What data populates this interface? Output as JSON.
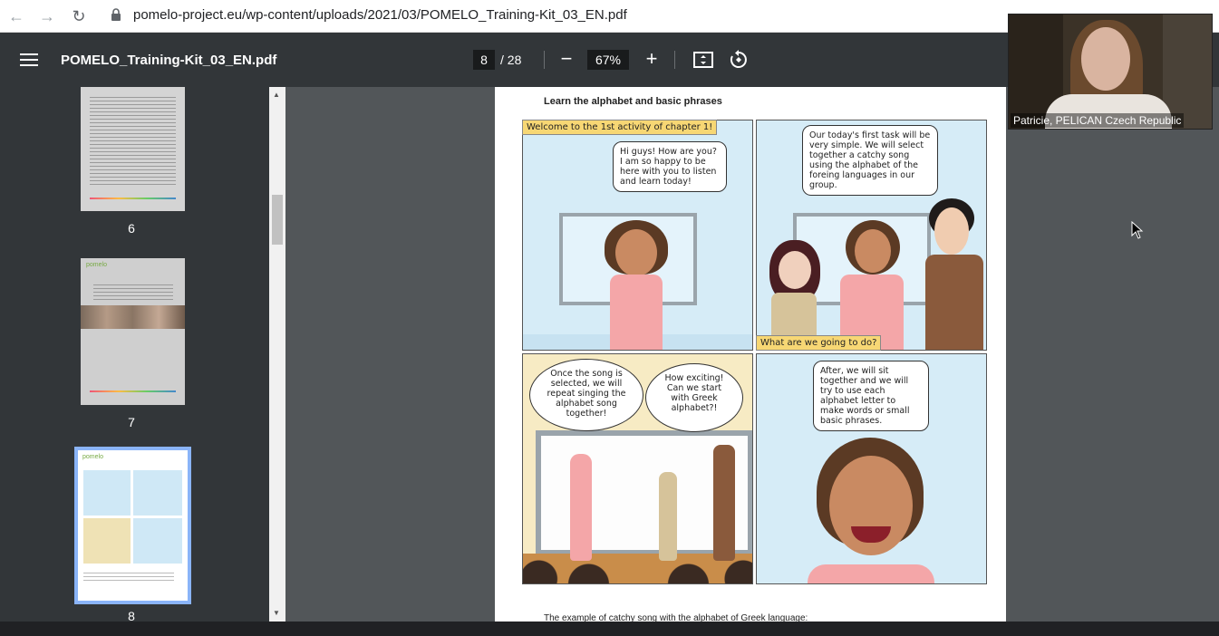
{
  "browser": {
    "url": "pomelo-project.eu/wp-content/uploads/2021/03/POMELO_Training-Kit_03_EN.pdf",
    "icons": [
      "back-icon",
      "forward-icon",
      "reload-icon",
      "lock-icon"
    ]
  },
  "toolbar": {
    "title": "POMELO_Training-Kit_03_EN.pdf",
    "current_page": "8",
    "total_pages": "/ 28",
    "zoom_out": "−",
    "zoom": "67%",
    "zoom_in": "+"
  },
  "sidebar": {
    "thumbnails": [
      {
        "number": "6"
      },
      {
        "number": "7"
      },
      {
        "number": "8",
        "selected": true
      }
    ]
  },
  "document": {
    "heading": "Learn the alphabet and basic phrases",
    "caption1": "Welcome to the 1st activity of chapter 1!",
    "bubble1": "Hi guys! How are you? I am so happy to be here with you to listen and learn today!",
    "bubble2": "Our today's first task will be very simple. We will select together a catchy song using the alphabet of the foreing languages in our group.",
    "caption2": "What are we going to do?",
    "bubble3": "Once the song is selected, we will repeat singing the alphabet song together!",
    "bubble4": "How exciting! Can we start with Greek alphabet?!",
    "bubble5": "After, we will sit together and we will try to use each alphabet letter to make words or small basic phrases.",
    "bottom_text": "The example of catchy song with the alphabet of Greek language:"
  },
  "video": {
    "participant": "Patricie, PELICAN Czech Republic"
  },
  "colors": {
    "toolbar": "#323639",
    "viewer_bg": "#525659",
    "caption": "#f7d774",
    "panel_sky": "#d6ecf7"
  }
}
